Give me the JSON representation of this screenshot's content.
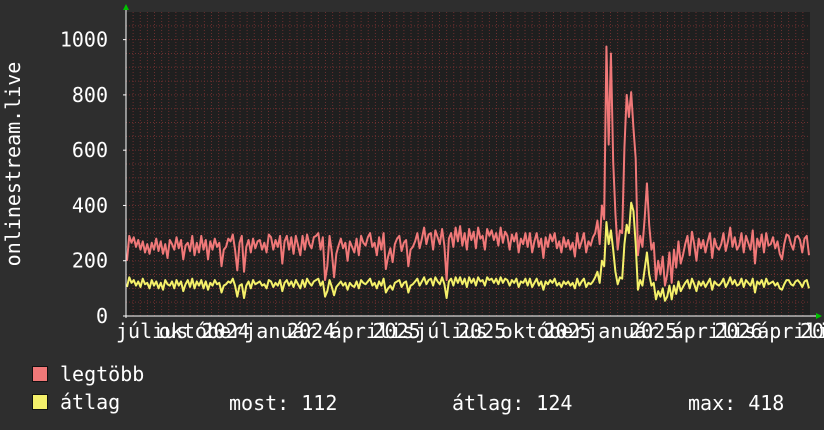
{
  "chart_data": {
    "type": "line",
    "ylabel": "onlinestream.live",
    "ylim": [
      0,
      1100
    ],
    "yticks": [
      "0",
      "200",
      "400",
      "600",
      "800",
      "1000"
    ],
    "ytick_values": [
      0,
      200,
      400,
      600,
      800,
      1000
    ],
    "xtick_labels": [
      "július",
      "október",
      "2024",
      "január",
      "2024",
      "április",
      "2025",
      "július",
      "2025",
      "október",
      "2025",
      "január",
      "2025",
      "április",
      "2026",
      "április",
      "20"
    ],
    "grid": true,
    "colors": {
      "background": "#2e2e2e",
      "plot": "#1f1f1f",
      "grid": "#6b2f2f",
      "axis": "#ffffff",
      "max_line": "#f07878",
      "avg_line": "#f4f06a",
      "arrow": "#00c000"
    },
    "series": [
      {
        "name": "legtöbb",
        "color": "#f07878",
        "values": [
          200,
          290,
          265,
          285,
          250,
          275,
          240,
          270,
          230,
          260,
          225,
          265,
          240,
          280,
          235,
          270,
          225,
          260,
          210,
          275,
          260,
          240,
          285,
          245,
          275,
          205,
          255,
          265,
          235,
          290,
          220,
          265,
          230,
          290,
          240,
          275,
          205,
          270,
          240,
          280,
          250,
          265,
          180,
          240,
          250,
          280,
          270,
          295,
          240,
          165,
          265,
          290,
          160,
          250,
          275,
          230,
          280,
          245,
          270,
          275,
          240,
          265,
          230,
          295,
          285,
          240,
          275,
          250,
          290,
          190,
          270,
          290,
          240,
          285,
          225,
          290,
          255,
          220,
          290,
          240,
          295,
          260,
          245,
          285,
          290,
          300,
          240,
          285,
          130,
          180,
          290,
          230,
          140,
          225,
          255,
          280,
          245,
          265,
          200,
          270,
          250,
          230,
          280,
          220,
          290,
          265,
          255,
          285,
          300,
          250,
          265,
          220,
          285,
          240,
          300,
          170,
          215,
          245,
          195,
          260,
          280,
          290,
          235,
          265,
          275,
          180,
          240,
          250,
          270,
          300,
          245,
          280,
          320,
          260,
          295,
          300,
          240,
          310,
          285,
          260,
          315,
          255,
          130,
          280,
          300,
          250,
          320,
          270,
          325,
          255,
          300,
          240,
          315,
          275,
          305,
          245,
          320,
          280,
          290,
          240,
          315,
          290,
          310,
          275,
          300,
          255,
          320,
          265,
          305,
          290,
          240,
          295,
          270,
          300,
          230,
          280,
          260,
          300,
          250,
          300,
          230,
          270,
          300,
          250,
          280,
          210,
          285,
          250,
          295,
          270,
          300,
          245,
          270,
          230,
          285,
          250,
          275,
          240,
          265,
          215,
          300,
          245,
          270,
          300,
          230,
          270,
          255,
          285,
          300,
          345,
          260,
          400,
          350,
          975,
          620,
          950,
          560,
          370,
          240,
          310,
          300,
          610,
          800,
          720,
          810,
          680,
          570,
          220,
          290,
          250,
          355,
          480,
          330,
          240,
          265,
          130,
          200,
          150,
          215,
          110,
          150,
          230,
          120,
          240,
          175,
          270,
          190,
          220,
          260,
          290,
          220,
          305,
          260,
          200,
          280,
          245,
          275,
          230,
          270,
          300,
          210,
          280,
          250,
          240,
          260,
          300,
          235,
          270,
          320,
          250,
          285,
          240,
          255,
          300,
          230,
          290,
          265,
          240,
          310,
          190,
          280,
          250,
          295,
          230,
          300,
          255,
          260,
          285,
          245,
          270,
          225,
          205,
          260,
          295,
          290,
          260,
          240,
          285,
          290,
          275,
          230,
          280,
          290,
          220
        ]
      },
      {
        "name": "átlag",
        "color": "#f4f06a",
        "values": [
          105,
          140,
          120,
          130,
          110,
          125,
          105,
          135,
          115,
          120,
          100,
          130,
          110,
          125,
          100,
          120,
          95,
          130,
          115,
          110,
          125,
          100,
          130,
          110,
          125,
          90,
          115,
          130,
          105,
          135,
          100,
          125,
          110,
          130,
          100,
          125,
          95,
          120,
          110,
          130,
          115,
          120,
          85,
          110,
          115,
          125,
          120,
          135,
          110,
          70,
          110,
          115,
          65,
          110,
          125,
          100,
          130,
          115,
          120,
          125,
          110,
          115,
          100,
          130,
          125,
          105,
          120,
          110,
          130,
          90,
          120,
          130,
          110,
          125,
          105,
          130,
          115,
          100,
          130,
          105,
          135,
          120,
          110,
          125,
          130,
          135,
          110,
          125,
          70,
          90,
          130,
          105,
          75,
          105,
          115,
          125,
          110,
          120,
          95,
          120,
          110,
          105,
          125,
          100,
          130,
          120,
          115,
          125,
          135,
          110,
          120,
          100,
          125,
          110,
          135,
          85,
          100,
          110,
          95,
          120,
          125,
          130,
          105,
          120,
          125,
          85,
          110,
          115,
          125,
          135,
          110,
          125,
          140,
          115,
          130,
          135,
          110,
          140,
          125,
          115,
          140,
          115,
          65,
          125,
          135,
          110,
          140,
          120,
          140,
          115,
          135,
          105,
          140,
          120,
          135,
          110,
          140,
          125,
          130,
          110,
          140,
          130,
          135,
          120,
          135,
          115,
          140,
          120,
          135,
          130,
          110,
          130,
          120,
          135,
          105,
          125,
          120,
          135,
          110,
          135,
          105,
          120,
          135,
          110,
          125,
          95,
          125,
          115,
          130,
          120,
          135,
          110,
          120,
          105,
          125,
          115,
          125,
          110,
          120,
          100,
          135,
          110,
          125,
          135,
          105,
          120,
          115,
          125,
          140,
          160,
          120,
          200,
          180,
          340,
          260,
          310,
          240,
          160,
          115,
          140,
          135,
          260,
          330,
          300,
          410,
          380,
          260,
          95,
          130,
          110,
          170,
          230,
          150,
          110,
          120,
          60,
          90,
          70,
          100,
          55,
          70,
          110,
          60,
          110,
          80,
          125,
          90,
          105,
          120,
          130,
          100,
          135,
          115,
          90,
          125,
          110,
          125,
          105,
          120,
          135,
          95,
          125,
          115,
          110,
          120,
          135,
          105,
          120,
          140,
          115,
          130,
          110,
          115,
          135,
          105,
          130,
          120,
          110,
          135,
          85,
          125,
          115,
          130,
          105,
          135,
          115,
          120,
          125,
          110,
          120,
          100,
          95,
          115,
          130,
          130,
          115,
          110,
          125,
          130,
          120,
          105,
          125,
          130,
          100
        ]
      }
    ]
  },
  "legend": [
    {
      "label": "legtöbb",
      "color": "#f07878"
    },
    {
      "label": "átlag",
      "color": "#f4f06a"
    }
  ],
  "stats": {
    "most": "most: 112",
    "atlag": "átlag: 124",
    "max": "max: 418"
  }
}
